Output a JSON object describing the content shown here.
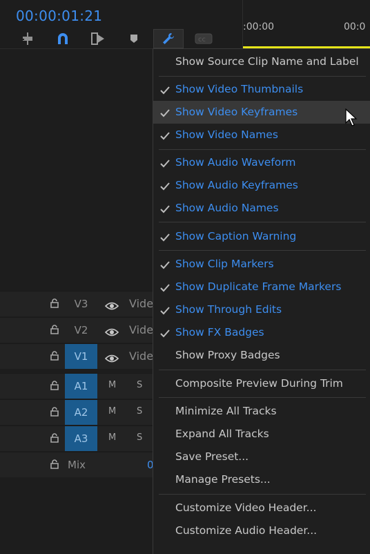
{
  "timecode": "00:00:01:21",
  "toolbar": {
    "tools": [
      {
        "name": "insert-sequence-nest-icon"
      },
      {
        "name": "snap-icon"
      },
      {
        "name": "linked-selection-icon"
      },
      {
        "name": "add-marker-icon"
      },
      {
        "name": "timeline-settings-wrench-icon"
      },
      {
        "name": "captions-icon"
      }
    ]
  },
  "ruler": {
    "labels": [
      ":00:00",
      "00:0"
    ],
    "playhead_range_color": "#e6e51a"
  },
  "tracks": {
    "video": [
      {
        "name": "V3",
        "label": "Vide"
      },
      {
        "name": "V2",
        "label": "Vide"
      },
      {
        "name": "V1",
        "label": "Vide"
      }
    ],
    "audio": [
      {
        "name": "A1",
        "m": "M",
        "s": "S"
      },
      {
        "name": "A2",
        "m": "M",
        "s": "S"
      },
      {
        "name": "A3",
        "m": "M",
        "s": "S"
      }
    ],
    "mix": {
      "name": "Mix",
      "value": "0"
    }
  },
  "menu": {
    "items": [
      {
        "label": "Show Source Clip Name and Label",
        "checked": false
      },
      {
        "label": "Show Video Thumbnails",
        "checked": true
      },
      {
        "label": "Show Video Keyframes",
        "checked": true,
        "highlighted": true
      },
      {
        "label": "Show Video Names",
        "checked": true
      },
      {
        "label": "Show Audio Waveform",
        "checked": true
      },
      {
        "label": "Show Audio Keyframes",
        "checked": true
      },
      {
        "label": "Show Audio Names",
        "checked": true
      },
      {
        "label": "Show Caption Warning",
        "checked": true
      },
      {
        "label": "Show Clip Markers",
        "checked": true
      },
      {
        "label": "Show Duplicate Frame Markers",
        "checked": true
      },
      {
        "label": "Show Through Edits",
        "checked": true
      },
      {
        "label": "Show FX Badges",
        "checked": true
      },
      {
        "label": "Show Proxy Badges",
        "checked": false
      },
      {
        "label": "Composite Preview During Trim",
        "checked": false
      },
      {
        "label": "Minimize All Tracks",
        "checked": false
      },
      {
        "label": "Expand All Tracks",
        "checked": false
      },
      {
        "label": "Save Preset...",
        "checked": false
      },
      {
        "label": "Manage Presets...",
        "checked": false
      },
      {
        "label": "Customize Video Header...",
        "checked": false
      },
      {
        "label": "Customize Audio Header...",
        "checked": false
      }
    ]
  },
  "colors": {
    "accent": "#3d8ef0",
    "track_selected": "#1b5b8e"
  }
}
